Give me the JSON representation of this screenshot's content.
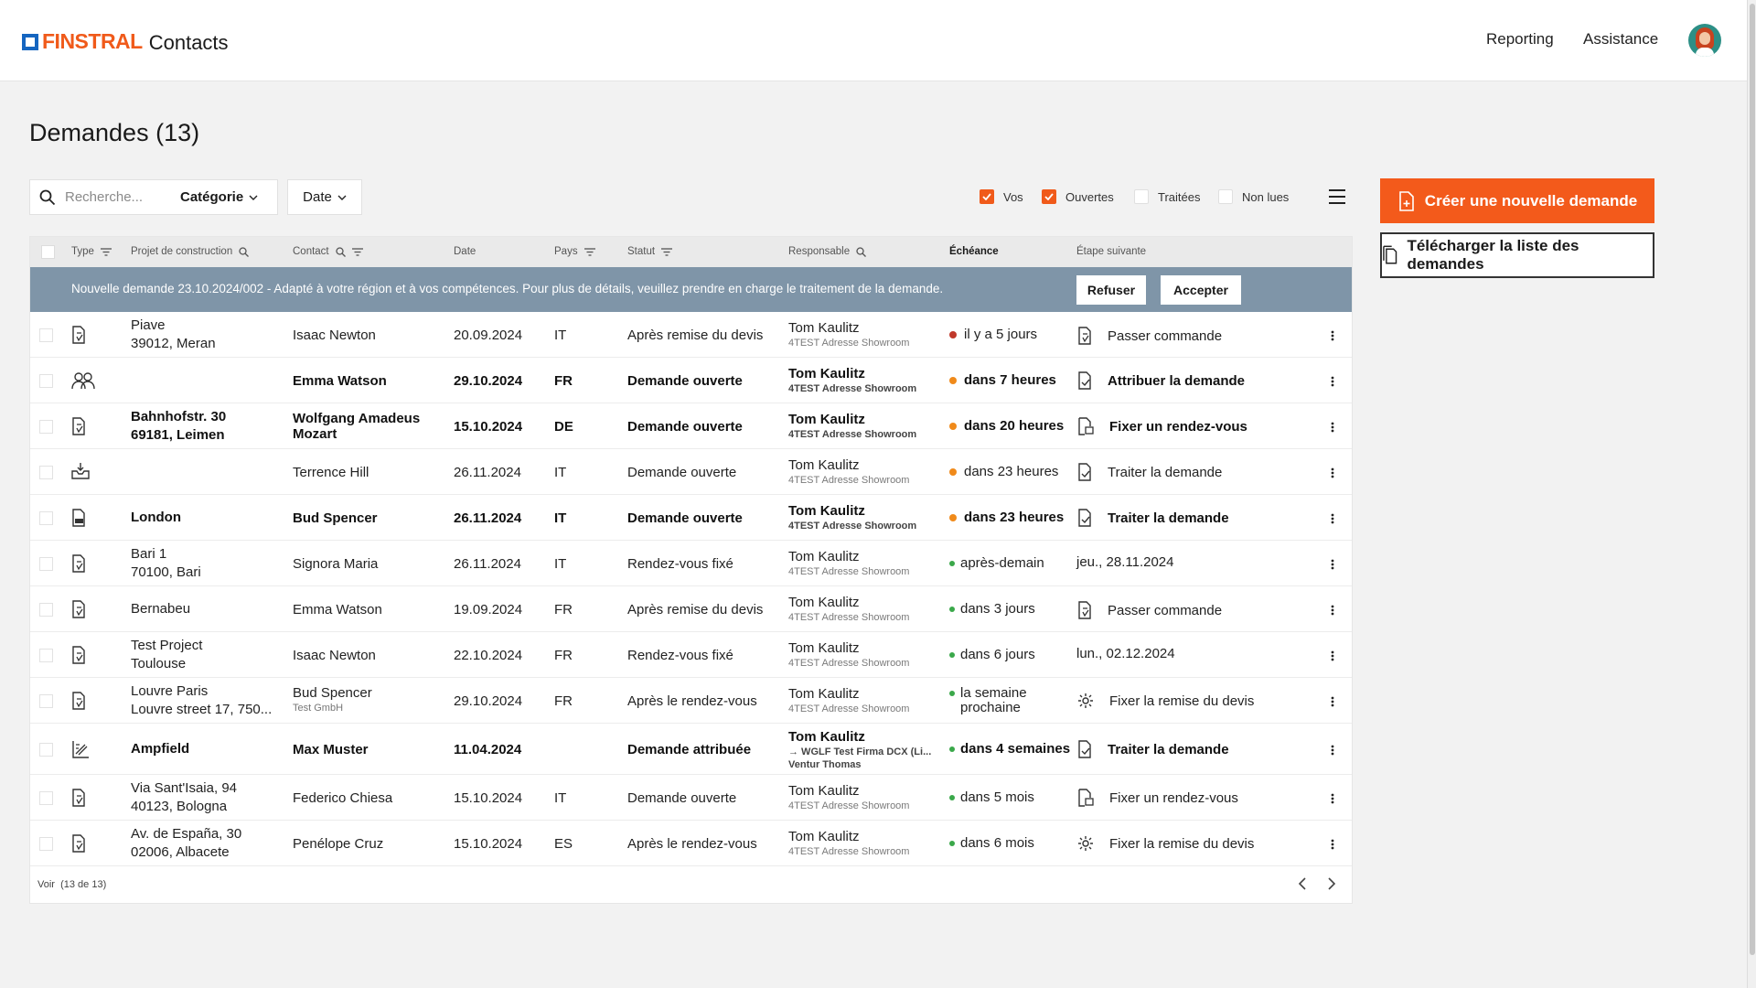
{
  "header": {
    "brand": "FINSTRAL",
    "app_name": "Contacts",
    "nav": [
      "Reporting",
      "Assistance"
    ]
  },
  "colors": {
    "accent": "#f35a1b",
    "logo_blue": "#1565c0",
    "banner": "#7f95a8",
    "dot_red": "#c0392b",
    "dot_orange": "#f08a1a",
    "dot_green": "#3aa84a"
  },
  "page": {
    "title": "Demandes (13)"
  },
  "filters": {
    "search_placeholder": "Recherche...",
    "category_label": "Catégorie",
    "date_label": "Date",
    "checkboxes": [
      {
        "label": "Vos",
        "checked": true
      },
      {
        "label": "Ouvertes",
        "checked": true
      },
      {
        "label": "Traitées",
        "checked": false
      },
      {
        "label": "Non lues",
        "checked": false
      }
    ]
  },
  "actions": {
    "create": "Créer une nouvelle demande",
    "download": "Télécharger la liste des demandes"
  },
  "table": {
    "columns": [
      "Type",
      "Projet de construction",
      "Contact",
      "Date",
      "Pays",
      "Statut",
      "Responsable",
      "Échéance",
      "Étape suivante"
    ],
    "banner": {
      "text": "Nouvelle demande 23.10.2024/002 - Adapté à votre région et à vos compétences. Pour plus de détails, veuillez prendre en charge le traitement de la demande.",
      "refuse": "Refuser",
      "accept": "Accepter"
    },
    "rows": [
      {
        "icon": "document-icon",
        "bold": false,
        "proj1": "Piave",
        "proj2": "39012, Meran",
        "contact": "Isaac Newton",
        "contact_sub": "",
        "date": "20.09.2024",
        "pays": "IT",
        "statut": "Après remise du devis",
        "resp": "Tom Kaulitz",
        "resp_sub": "4TEST Adresse Showroom",
        "resp_sub2": "",
        "ech_color": "red",
        "ech": "il y a 5 jours",
        "step_icon": "document-icon",
        "step": "Passer commande"
      },
      {
        "icon": "group-icon",
        "bold": true,
        "proj1": "",
        "proj2": "",
        "contact": "Emma Watson",
        "contact_sub": "",
        "date": "29.10.2024",
        "pays": "FR",
        "statut": "Demande ouverte",
        "resp": "Tom Kaulitz",
        "resp_sub": "4TEST Adresse Showroom",
        "resp_sub2": "",
        "ech_color": "orange",
        "ech": "dans 7 heures",
        "step_icon": "assign-icon",
        "step": "Attribuer la demande"
      },
      {
        "icon": "document-icon",
        "bold": true,
        "proj1": "Bahnhofstr. 30",
        "proj2": "69181, Leimen",
        "contact": "Wolfgang Amadeus Mozart",
        "contact_sub": "",
        "date": "15.10.2024",
        "pays": "DE",
        "statut": "Demande ouverte",
        "resp": "Tom Kaulitz",
        "resp_sub": "4TEST Adresse Showroom",
        "resp_sub2": "",
        "ech_color": "orange",
        "ech": "dans 20 heures",
        "step_icon": "calendar-doc-icon",
        "step": "Fixer un rendez-vous"
      },
      {
        "icon": "inbox-icon",
        "bold": false,
        "proj1": "",
        "proj2": "",
        "contact": "Terrence Hill",
        "contact_sub": "",
        "date": "26.11.2024",
        "pays": "IT",
        "statut": "Demande ouverte",
        "resp": "Tom Kaulitz",
        "resp_sub": "4TEST Adresse Showroom",
        "resp_sub2": "",
        "ech_color": "orange",
        "ech": "dans 23 heures",
        "step_icon": "assign-icon",
        "step": "Traiter la demande"
      },
      {
        "icon": "dwg-icon",
        "bold": true,
        "proj1": "London",
        "proj2": "",
        "contact": "Bud Spencer",
        "contact_sub": "",
        "date": "26.11.2024",
        "pays": "IT",
        "statut": "Demande ouverte",
        "resp": "Tom Kaulitz",
        "resp_sub": "4TEST Adresse Showroom",
        "resp_sub2": "",
        "ech_color": "orange",
        "ech": "dans 23 heures",
        "step_icon": "assign-icon",
        "step": "Traiter la demande"
      },
      {
        "icon": "document-icon",
        "bold": false,
        "proj1": "Bari 1",
        "proj2": "70100, Bari",
        "contact": "Signora Maria",
        "contact_sub": "",
        "date": "26.11.2024",
        "pays": "IT",
        "statut": "Rendez-vous fixé",
        "resp": "Tom Kaulitz",
        "resp_sub": "4TEST Adresse Showroom",
        "resp_sub2": "",
        "ech_color": "green",
        "ech": "après-demain",
        "step_icon": "",
        "step": "jeu., 28.11.2024"
      },
      {
        "icon": "document-icon",
        "bold": false,
        "proj1": "Bernabeu",
        "proj2": "",
        "contact": "Emma Watson",
        "contact_sub": "",
        "date": "19.09.2024",
        "pays": "FR",
        "statut": "Après remise du devis",
        "resp": "Tom Kaulitz",
        "resp_sub": "4TEST Adresse Showroom",
        "resp_sub2": "",
        "ech_color": "green",
        "ech": "dans 3 jours",
        "step_icon": "document-icon",
        "step": "Passer commande"
      },
      {
        "icon": "document-icon",
        "bold": false,
        "proj1": "Test Project",
        "proj2": "Toulouse",
        "contact": "Isaac Newton",
        "contact_sub": "",
        "date": "22.10.2024",
        "pays": "FR",
        "statut": "Rendez-vous fixé",
        "resp": "Tom Kaulitz",
        "resp_sub": "4TEST Adresse Showroom",
        "resp_sub2": "",
        "ech_color": "green",
        "ech": "dans 6 jours",
        "step_icon": "",
        "step": "lun., 02.12.2024"
      },
      {
        "icon": "document-icon",
        "bold": false,
        "proj1": "Louvre Paris",
        "proj2": "Louvre street 17, 750...",
        "contact": "Bud Spencer",
        "contact_sub": "Test GmbH",
        "date": "29.10.2024",
        "pays": "FR",
        "statut": "Après le rendez-vous",
        "resp": "Tom Kaulitz",
        "resp_sub": "4TEST Adresse Showroom",
        "resp_sub2": "",
        "ech_color": "green",
        "ech": "la semaine prochaine",
        "step_icon": "gear-doc-icon",
        "step": "Fixer la remise du devis"
      },
      {
        "icon": "measure-icon",
        "bold": true,
        "proj1": "Ampfield",
        "proj2": "",
        "contact": "Max Muster",
        "contact_sub": "",
        "date": "11.04.2024",
        "pays": "",
        "statut": "Demande attribuée",
        "resp": "Tom Kaulitz",
        "resp_sub": "→ WGLF Test Firma DCX (Li...",
        "resp_sub2": "Ventur Thomas",
        "ech_color": "green",
        "ech": "dans 4 semaines",
        "step_icon": "assign-icon",
        "step": "Traiter la demande"
      },
      {
        "icon": "document-icon",
        "bold": false,
        "proj1": "Via Sant'Isaia, 94",
        "proj2": "40123, Bologna",
        "contact": "Federico Chiesa",
        "contact_sub": "",
        "date": "15.10.2024",
        "pays": "IT",
        "statut": "Demande ouverte",
        "resp": "Tom Kaulitz",
        "resp_sub": "4TEST Adresse Showroom",
        "resp_sub2": "",
        "ech_color": "green",
        "ech": "dans 5 mois",
        "step_icon": "calendar-doc-icon",
        "step": "Fixer un rendez-vous"
      },
      {
        "icon": "document-icon",
        "bold": false,
        "proj1": "Av. de España, 30",
        "proj2": "02006, Albacete",
        "contact": "Penélope Cruz",
        "contact_sub": "",
        "date": "15.10.2024",
        "pays": "ES",
        "statut": "Après le rendez-vous",
        "resp": "Tom Kaulitz",
        "resp_sub": "4TEST Adresse Showroom",
        "resp_sub2": "",
        "ech_color": "green",
        "ech": "dans 6 mois",
        "step_icon": "gear-doc-icon",
        "step": "Fixer la remise du devis"
      }
    ],
    "footer": {
      "voir": "Voir",
      "count": "(13 de 13)"
    }
  }
}
